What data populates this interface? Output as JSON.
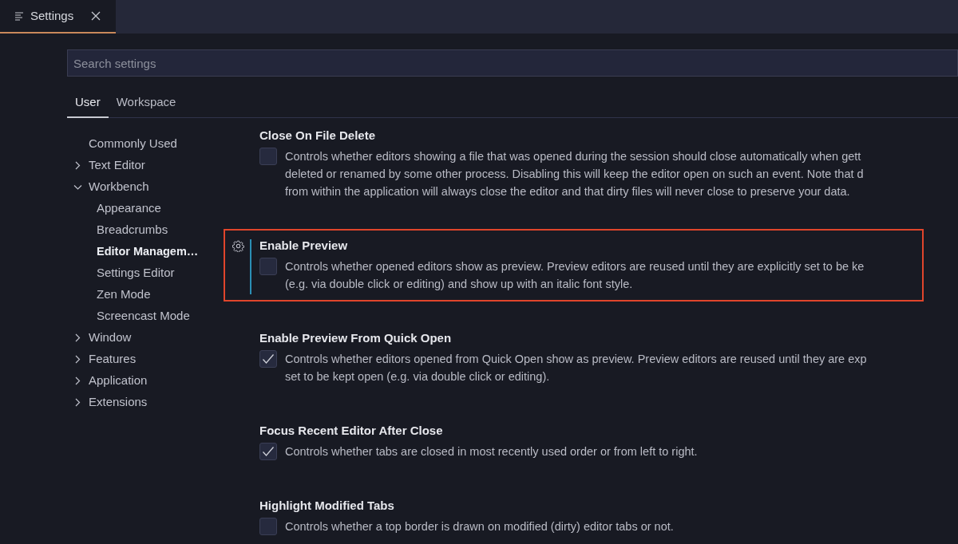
{
  "editor_tab": {
    "title": "Settings",
    "selected": true
  },
  "search": {
    "placeholder": "Search settings"
  },
  "scope_tabs": [
    {
      "label": "User",
      "selected": true
    },
    {
      "label": "Workspace",
      "selected": false
    }
  ],
  "toc": [
    {
      "label": "Commonly Used",
      "selected": false
    },
    {
      "label": "Text Editor",
      "expanded": false,
      "selected": false
    },
    {
      "label": "Workbench",
      "expanded": true,
      "selected": false,
      "children": [
        {
          "label": "Appearance",
          "selected": false
        },
        {
          "label": "Breadcrumbs",
          "selected": false
        },
        {
          "label": "Editor Managem…",
          "selected": true
        },
        {
          "label": "Settings Editor",
          "selected": false
        },
        {
          "label": "Zen Mode",
          "selected": false
        },
        {
          "label": "Screencast Mode",
          "selected": false
        }
      ]
    },
    {
      "label": "Window",
      "expanded": false,
      "selected": false
    },
    {
      "label": "Features",
      "expanded": false,
      "selected": false
    },
    {
      "label": "Application",
      "expanded": false,
      "selected": false
    },
    {
      "label": "Extensions",
      "expanded": false,
      "selected": false
    }
  ],
  "settings": [
    {
      "title": "Close On File Delete",
      "checked": false,
      "focused": false,
      "description": [
        "Controls whether editors showing a file that was opened during the session should close automatically when gett",
        "deleted or renamed by some other process. Disabling this will keep the editor open on such an event. Note that d",
        "from within the application will always close the editor and that dirty files will never close to preserve your data."
      ]
    },
    {
      "title": "Enable Preview",
      "checked": false,
      "focused": true,
      "description": [
        "Controls whether opened editors show as preview. Preview editors are reused until they are explicitly set to be ke",
        "(e.g. via double click or editing) and show up with an italic font style."
      ]
    },
    {
      "title": "Enable Preview From Quick Open",
      "checked": true,
      "focused": false,
      "description": [
        "Controls whether editors opened from Quick Open show as preview. Preview editors are reused until they are exp",
        "set to be kept open (e.g. via double click or editing)."
      ]
    },
    {
      "title": "Focus Recent Editor After Close",
      "checked": true,
      "focused": false,
      "description": [
        "Controls whether tabs are closed in most recently used order or from left to right."
      ]
    },
    {
      "title": "Highlight Modified Tabs",
      "checked": false,
      "focused": false,
      "description": [
        "Controls whether a top border is drawn on modified (dirty) editor tabs or not."
      ]
    }
  ]
}
